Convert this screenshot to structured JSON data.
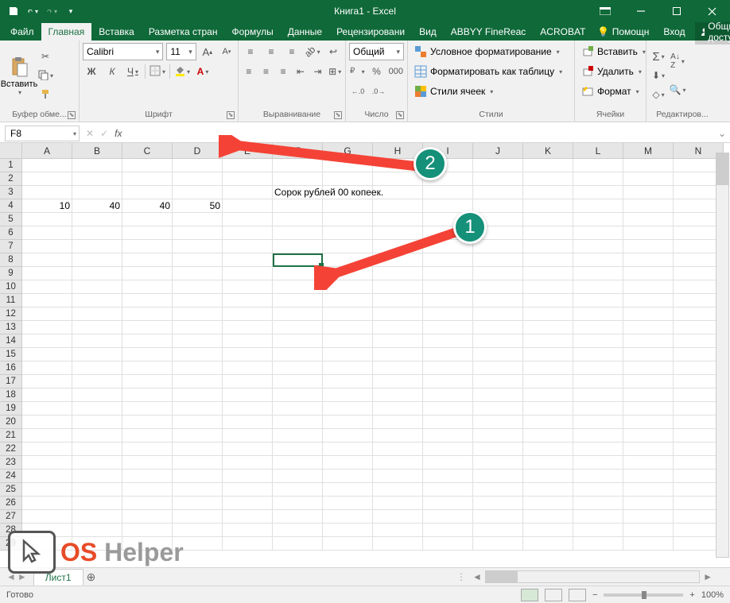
{
  "title": "Книга1 - Excel",
  "tabs": {
    "file": "Файл",
    "home": "Главная",
    "insert": "Вставка",
    "layout": "Разметка стран",
    "formulas": "Формулы",
    "data": "Данные",
    "review": "Рецензировани",
    "view": "Вид",
    "abbyy": "ABBYY FineReac",
    "acrobat": "ACROBAT",
    "tell": "Помощн",
    "signin": "Вход",
    "share": "Общий доступ"
  },
  "ribbon": {
    "clipboard": {
      "paste": "Вставить",
      "label": "Буфер обме..."
    },
    "font": {
      "label": "Шрифт",
      "name": "Calibri",
      "size": "11",
      "bold": "Ж",
      "italic": "К",
      "underline": "Ч"
    },
    "align": {
      "label": "Выравнивание"
    },
    "number": {
      "label": "Число",
      "format": "Общий"
    },
    "styles": {
      "label": "Стили",
      "cond": "Условное форматирование",
      "table": "Форматировать как таблицу",
      "cell": "Стили ячеек"
    },
    "cells": {
      "label": "Ячейки",
      "insert": "Вставить",
      "delete": "Удалить",
      "format": "Формат"
    },
    "editing": {
      "label": "Редактиров..."
    }
  },
  "namebox": "F8",
  "cols": [
    "A",
    "B",
    "C",
    "D",
    "E",
    "F",
    "G",
    "H",
    "I",
    "J",
    "K",
    "L",
    "M",
    "N"
  ],
  "rows": [
    "1",
    "2",
    "3",
    "4",
    "5",
    "6",
    "7",
    "8",
    "9",
    "10",
    "11",
    "12",
    "13",
    "14",
    "15",
    "16",
    "17",
    "18",
    "19",
    "20",
    "21",
    "22",
    "23",
    "24",
    "25",
    "26",
    "27",
    "28",
    "29"
  ],
  "data": {
    "r3_f": "Сорок рублей  00 копеек.",
    "r4_a": "10",
    "r4_b": "40",
    "r4_c": "40",
    "r4_d": "50"
  },
  "sheet": "Лист1",
  "status": "Готово",
  "zoom": "100%",
  "ann": {
    "one": "1",
    "two": "2"
  },
  "logo": {
    "os": "OS",
    "helper": "Helper"
  }
}
